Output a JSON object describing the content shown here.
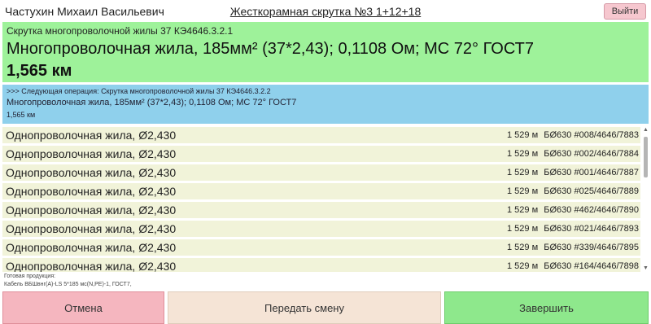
{
  "header": {
    "operator": "Частухин Михаил Васильевич",
    "machine": "Жесткорамная скрутка №3 1+12+18",
    "logout_label": "Выйти"
  },
  "current": {
    "operation": "Скрутка многопроволочной жилы 37 КЭ4646.3.2.1",
    "description": "Многопроволочная жила, 185мм² (37*2,43); 0,1108 Ом; МС 72° ГОСТ7",
    "length": "1,565 км"
  },
  "next": {
    "operation": ">>> Следующая операция: Скрутка многопроволочной жилы 37 КЭ4646.3.2.2",
    "description": "Многопроволочная жила, 185мм² (37*2,43); 0,1108 Ом; МС 72° ГОСТ7",
    "length": "1,565 км"
  },
  "materials": [
    {
      "name": "Однопроволочная жила, Ø2,430",
      "length": "1 529 м",
      "source": "БØ630 #008/4646/7883"
    },
    {
      "name": "Однопроволочная жила, Ø2,430",
      "length": "1 529 м",
      "source": "БØ630 #002/4646/7884"
    },
    {
      "name": "Однопроволочная жила, Ø2,430",
      "length": "1 529 м",
      "source": "БØ630 #001/4646/7887"
    },
    {
      "name": "Однопроволочная жила, Ø2,430",
      "length": "1 529 м",
      "source": "БØ630 #025/4646/7889"
    },
    {
      "name": "Однопроволочная жила, Ø2,430",
      "length": "1 529 м",
      "source": "БØ630 #462/4646/7890"
    },
    {
      "name": "Однопроволочная жила, Ø2,430",
      "length": "1 529 м",
      "source": "БØ630 #021/4646/7893"
    },
    {
      "name": "Однопроволочная жила, Ø2,430",
      "length": "1 529 м",
      "source": "БØ630 #339/4646/7895"
    },
    {
      "name": "Однопроволочная жила, Ø2,430",
      "length": "1 529 м",
      "source": "БØ630 #164/4646/7898"
    }
  ],
  "product": {
    "label": "Готовая продукция:",
    "value": "Кабель ВБШвнг(А)-LS 5*185 мс(N,PE)-1, ГОСТ7,"
  },
  "buttons": {
    "cancel": "Отмена",
    "handover": "Передать смену",
    "finish": "Завершить"
  },
  "scrollbar": {
    "up_glyph": "▲",
    "down_glyph": "▼"
  },
  "colors": {
    "current_bg": "#9ef29a",
    "next_bg": "#8fd0ec",
    "row_bg": "#f1f3d9",
    "cancel_bg": "#f5b6bf",
    "handover_bg": "#f5e4d6",
    "finish_bg": "#8ee88c",
    "logout_bg": "#f6c7cf"
  }
}
